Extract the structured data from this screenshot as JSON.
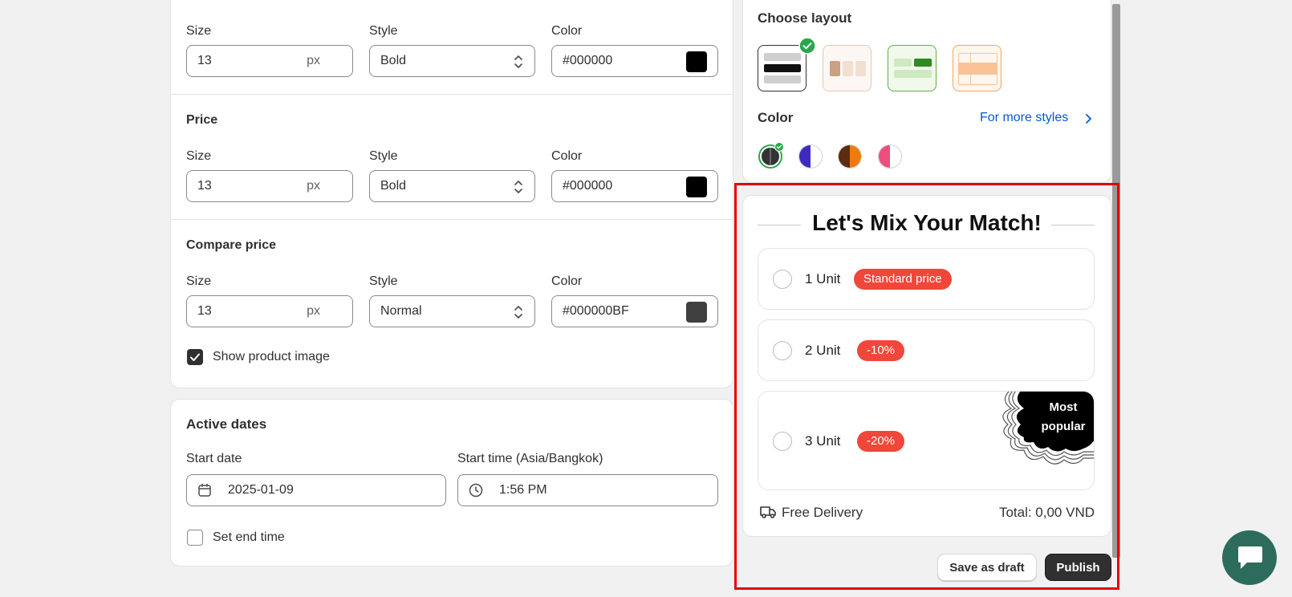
{
  "typography": {
    "title_row": {
      "size_label": "Size",
      "size_value": "13",
      "size_unit": "px",
      "style_label": "Style",
      "style_value": "Bold",
      "color_label": "Color",
      "color_value": "#000000",
      "swatch": "#000000"
    },
    "price": {
      "title": "Price",
      "size_label": "Size",
      "size_value": "13",
      "size_unit": "px",
      "style_label": "Style",
      "style_value": "Bold",
      "color_label": "Color",
      "color_value": "#000000",
      "swatch": "#000000"
    },
    "compare_price": {
      "title": "Compare price",
      "size_label": "Size",
      "size_value": "13",
      "size_unit": "px",
      "style_label": "Style",
      "style_value": "Normal",
      "color_label": "Color",
      "color_value": "#000000BF",
      "swatch": "#404040"
    },
    "show_product_image": {
      "label": "Show product image",
      "checked": true
    }
  },
  "active_dates": {
    "title": "Active dates",
    "start_date_label": "Start date",
    "start_date_value": "2025-01-09",
    "start_time_label": "Start time (Asia/Bangkok)",
    "start_time_value": "1:56 PM",
    "set_end_time": {
      "label": "Set end time",
      "checked": false
    }
  },
  "layout": {
    "title": "Choose layout",
    "color_title": "Color",
    "more_styles_link": "For more styles",
    "options": [
      "layout-stacked",
      "layout-grid-beige",
      "layout-grid-green",
      "layout-table-orange"
    ],
    "selected": 0,
    "colors": [
      {
        "name": "dark",
        "left": "#333333",
        "right": "#333333"
      },
      {
        "name": "indigo",
        "left": "#3d2bc0",
        "right": "#ffffff"
      },
      {
        "name": "orange",
        "left": "#5a2c10",
        "right": "#f07a10"
      },
      {
        "name": "pink",
        "left": "#f04d7f",
        "right": "#ffffff"
      }
    ]
  },
  "preview": {
    "title": "Let's Mix Your Match!",
    "options": [
      {
        "label": "1 Unit",
        "badge": "Standard price"
      },
      {
        "label": "2 Unit",
        "badge": "-10%"
      },
      {
        "label": "3 Unit",
        "badge": "-20%",
        "ribbon_line1": "Most",
        "ribbon_line2": "popular"
      }
    ],
    "free_delivery": "Free Delivery",
    "total": "Total: 0,00 VND"
  },
  "actions": {
    "save_draft": "Save as draft",
    "publish": "Publish"
  },
  "colors": {
    "accent_link": "#005bd3",
    "badge": "#f0473a",
    "highlight": "#e50000",
    "success": "#29a84b",
    "chat": "#2d6c5c"
  }
}
